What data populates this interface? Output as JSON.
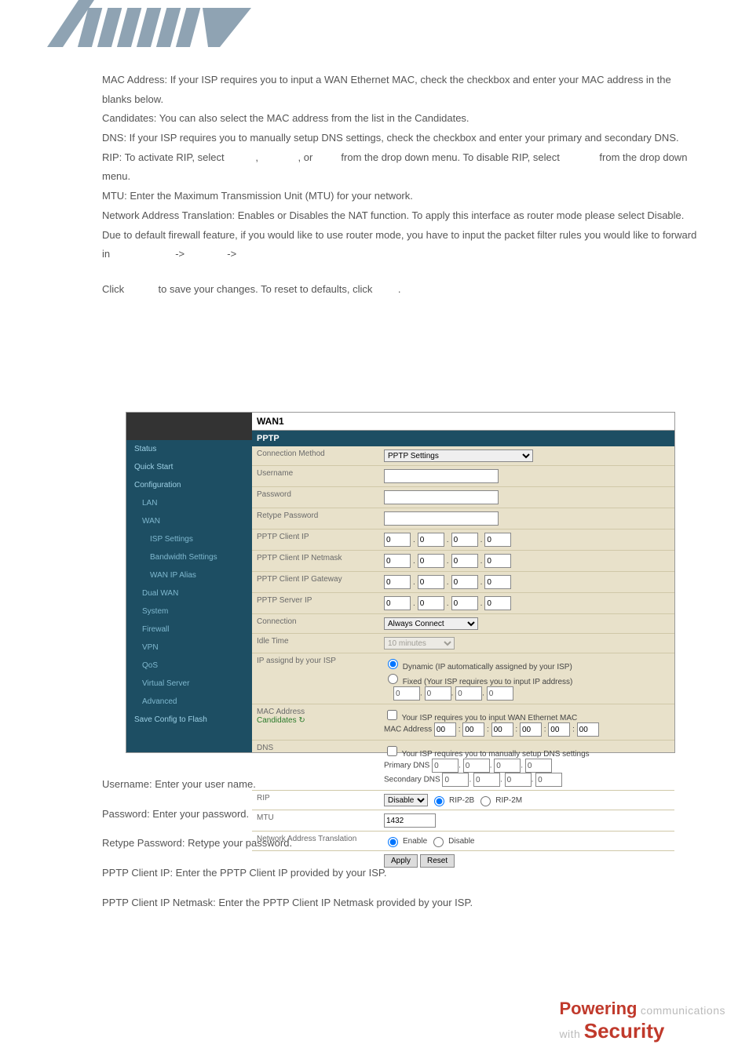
{
  "doc": {
    "p1": "MAC Address: If your ISP requires you to input a WAN Ethernet MAC, check the checkbox and enter your MAC address in the blanks below.",
    "p2": "Candidates: You can also select the MAC address from the list in the Candidates.",
    "p3": "DNS: If your ISP requires you to manually setup DNS settings, check the checkbox and enter your primary and secondary DNS.",
    "p4": "RIP: To activate RIP, select           ,              , or          from the drop down menu. To disable RIP, select              from the drop down menu.",
    "p5": "MTU: Enter the Maximum Transmission Unit (MTU) for your network.",
    "p6": "Network Address Translation: Enables or Disables the NAT function. To apply this interface as router mode please select Disable. Due to default firewall feature, if you would like to use router mode, you have to input the packet filter rules you would like to forward in                       ->               ->",
    "p7": "Click            to save your changes. To reset to defaults, click         .",
    "u1": "Username: Enter your user name.",
    "u2": "Password: Enter your password.",
    "u3": "Retype Password: Retype your password.",
    "u4": "PPTP Client IP: Enter the PPTP Client IP provided by your ISP.",
    "u5": "PPTP Client IP Netmask: Enter the PPTP Client IP Netmask provided by your ISP."
  },
  "sidebar": {
    "items": [
      "Status",
      "Quick Start",
      "Configuration",
      "LAN",
      "WAN",
      "ISP Settings",
      "Bandwidth Settings",
      "WAN IP Alias",
      "Dual WAN",
      "System",
      "Firewall",
      "VPN",
      "QoS",
      "Virtual Server",
      "Advanced",
      "Save Config to Flash"
    ]
  },
  "main": {
    "title": "WAN1",
    "subtitle": "PPTP",
    "rows": {
      "conn_method_lab": "Connection Method",
      "conn_method_val": "PPTP Settings",
      "username_lab": "Username",
      "password_lab": "Password",
      "retype_lab": "Retype Password",
      "pptp_ip_lab": "PPTP Client IP",
      "pptp_nm_lab": "PPTP Client IP Netmask",
      "pptp_gw_lab": "PPTP Client IP Gateway",
      "pptp_srv_lab": "PPTP Server IP",
      "connection_lab": "Connection",
      "connection_val": "Always Connect",
      "idle_lab": "Idle Time",
      "idle_val": "10 minutes",
      "ip_assign_lab": "IP assignd by your ISP",
      "ip_dyn": "Dynamic (IP automatically assigned by your ISP)",
      "ip_fix": "Fixed (Your ISP requires you to input IP address)",
      "mac_lab": "MAC Address",
      "cand_lab": "Candidates",
      "mac_note": "Your ISP requires you to input WAN Ethernet MAC",
      "mac_prefix": "MAC Address",
      "dns_lab": "DNS",
      "dns_note": "Your ISP requires you to manually setup DNS settings",
      "dns_pri": "Primary DNS",
      "dns_sec": "Secondary DNS",
      "rip_lab": "RIP",
      "rip_sel": "Disable",
      "rip_2b": "RIP-2B",
      "rip_2m": "RIP-2M",
      "mtu_lab": "MTU",
      "mtu_val": "1432",
      "nat_lab": "Network Address Translation",
      "nat_en": "Enable",
      "nat_dis": "Disable",
      "apply": "Apply",
      "reset": "Reset",
      "oct": "0",
      "mac_oct": "00",
      "candidates_arrow": "↻"
    }
  },
  "footer": {
    "p1a": "Powering",
    "p1b": " communications",
    "p2a": "with ",
    "p2b": "Security"
  }
}
